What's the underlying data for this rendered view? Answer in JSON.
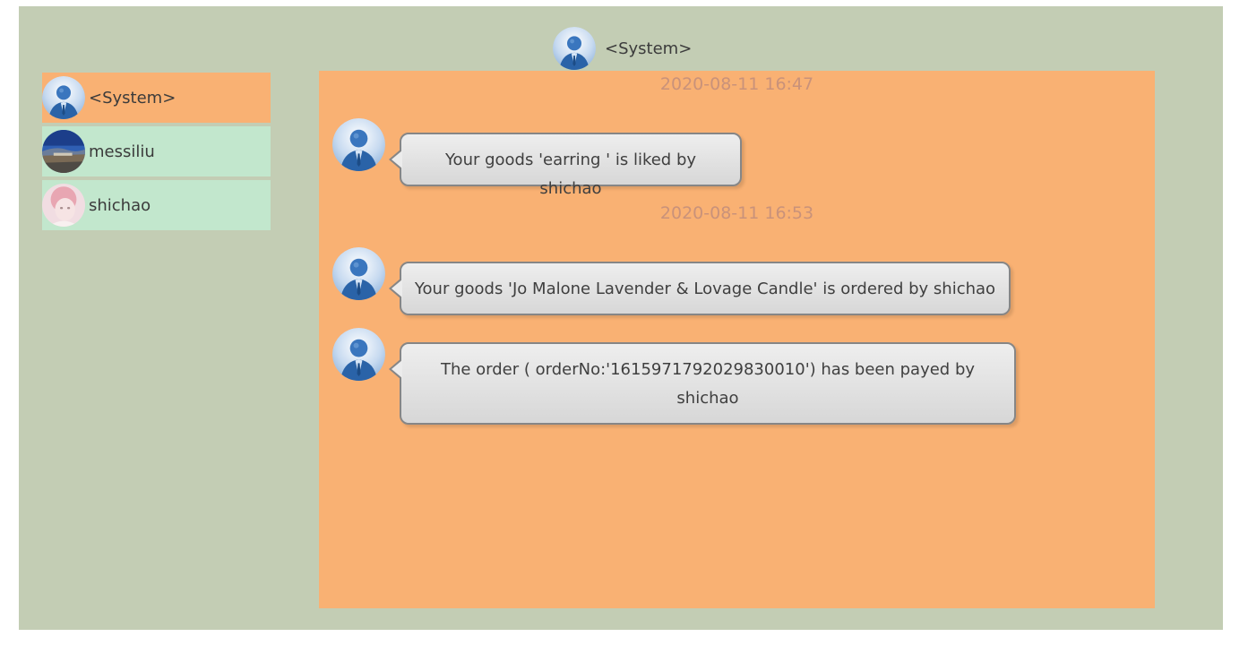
{
  "header": {
    "title": "<System>",
    "avatar_icon": "system-user-avatar"
  },
  "sidebar": {
    "contacts": [
      {
        "name": "<System>",
        "avatar_icon": "system-user-avatar",
        "active": true
      },
      {
        "name": "messiliu",
        "avatar_icon": "landscape-photo-avatar",
        "active": false
      },
      {
        "name": "shichao",
        "avatar_icon": "pink-portrait-avatar",
        "active": false
      }
    ]
  },
  "chat": {
    "timestamps": [
      "2020-08-11 16:47",
      "2020-08-11 16:53"
    ],
    "messages": [
      {
        "text": "Your goods 'earring ' is liked by shichao"
      },
      {
        "text": "Your goods 'Jo Malone Lavender & Lovage Candle' is ordered by shichao"
      },
      {
        "text": "The order ( orderNo:'1615971792029830010') has been payed by shichao"
      }
    ]
  },
  "colors": {
    "app_background": "#c3cdb4",
    "chat_background": "#f9b173",
    "active_contact": "#f9b173",
    "contact_background": "#c2e7cd",
    "timestamp_text": "#c9927a"
  }
}
